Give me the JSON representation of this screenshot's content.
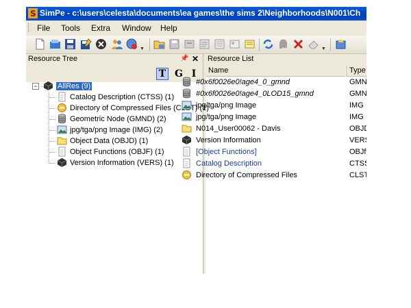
{
  "window": {
    "title": "SimPe - c:\\users\\celesta\\documents\\ea games\\the sims 2\\Neighborhoods\\N001\\Ch"
  },
  "menu": [
    "File",
    "Tools",
    "Extra",
    "Window",
    "Help"
  ],
  "toolbar_icons": [
    "new-file-icon",
    "open-icon",
    "save-icon",
    "save-as-icon",
    "close-icon",
    "people-icon",
    "globe-icon",
    "open-folder-icon",
    "floppy-icon",
    "archive-icon",
    "sheet-icon",
    "notes-icon",
    "card-icon",
    "note-icon",
    "refresh-icon",
    "ghost-icon",
    "delete-icon",
    "eraser-icon",
    "package-icon"
  ],
  "resource_tree": {
    "title": "Resource Tree",
    "buttons": [
      "T",
      "G",
      "I"
    ],
    "root": "AllRes (9)",
    "items": [
      {
        "label": "Catalog Description (CTSS) (1)",
        "icon": "document-icon"
      },
      {
        "label": "Directory of Compressed Files (CLST) (1)",
        "icon": "compressed-dir-icon"
      },
      {
        "label": "Geometric Node (GMND) (2)",
        "icon": "cylinder-icon"
      },
      {
        "label": "jpg/tga/png Image (IMG) (2)",
        "icon": "image-icon"
      },
      {
        "label": "Object Data (OBJD) (1)",
        "icon": "folder-icon"
      },
      {
        "label": "Object Functions (OBJF) (1)",
        "icon": "document-icon"
      },
      {
        "label": "Version Information (VERS) (1)",
        "icon": "cube-icon"
      }
    ]
  },
  "resource_list": {
    "title": "Resource List",
    "columns": [
      "Name",
      "Type"
    ],
    "rows": [
      {
        "name": "#0x6f0026e0!age4_0_gmnd",
        "type": "GMN",
        "icon": "cylinder-icon",
        "style": "italic"
      },
      {
        "name": "#0x6f0026e0!age4_0LOD15_gmnd",
        "type": "GMN",
        "icon": "cylinder-icon",
        "style": "italic"
      },
      {
        "name": "jpg/tga/png Image",
        "type": "IMG",
        "icon": "image-icon",
        "style": "normal"
      },
      {
        "name": "jpg/tga/png Image",
        "type": "IMG",
        "icon": "image-icon",
        "style": "normal"
      },
      {
        "name": "N014_User00062 - Davis",
        "type": "OBJD",
        "icon": "folder-icon",
        "style": "normal"
      },
      {
        "name": "Version Information",
        "type": "VERS",
        "icon": "cube-icon",
        "style": "normal"
      },
      {
        "name": "[Object Functions]",
        "type": "OBJf",
        "icon": "document-icon",
        "style": "blue"
      },
      {
        "name": "Catalog Description",
        "type": "CTSS",
        "icon": "document-icon",
        "style": "blue"
      },
      {
        "name": "Directory of Compressed Files",
        "type": "CLST",
        "icon": "compressed-dir-icon",
        "style": "normal"
      }
    ]
  }
}
